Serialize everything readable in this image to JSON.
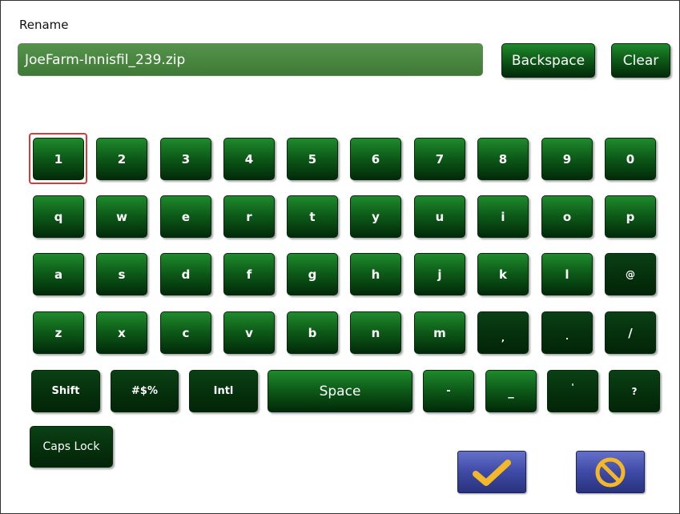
{
  "dialog": {
    "title": "Rename"
  },
  "filename": {
    "value": "JoeFarm-Innisfil_239.zip"
  },
  "buttons": {
    "backspace": "Backspace",
    "clear": "Clear"
  },
  "keys": {
    "row_numbers": [
      "1",
      "2",
      "3",
      "4",
      "5",
      "6",
      "7",
      "8",
      "9",
      "0"
    ],
    "row_q": [
      "q",
      "w",
      "e",
      "r",
      "t",
      "y",
      "u",
      "i",
      "o",
      "p"
    ],
    "row_a": [
      "a",
      "s",
      "d",
      "f",
      "g",
      "h",
      "j",
      "k",
      "l",
      "@"
    ],
    "row_z": [
      "z",
      "x",
      "c",
      "v",
      "b",
      "n",
      "m",
      ",",
      ".",
      "/"
    ],
    "bottom": {
      "shift": "Shift",
      "symbols": "#$%",
      "intl": "Intl",
      "space": "Space",
      "dash": "-",
      "underscore": "_",
      "apostrophe": "'",
      "question": "?"
    },
    "caps_lock": "Caps Lock"
  },
  "actions": {
    "confirm_icon": "checkmark-icon",
    "cancel_icon": "cancel-icon"
  },
  "colors": {
    "key_green": "#0d5a18",
    "field_green": "#4a8a40",
    "focus": "#d63a3a",
    "action_blue": "#3e4aa6"
  }
}
